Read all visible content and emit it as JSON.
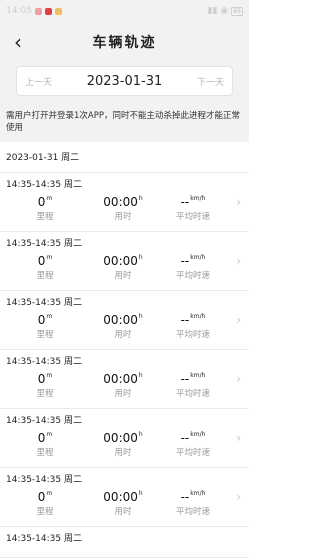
{
  "status": {
    "battery": "65"
  },
  "header": {
    "back_icon": "back-chevron",
    "title": "车辆轨迹"
  },
  "date_nav": {
    "prev": "上一天",
    "date": "2023-01-31",
    "next": "下一天"
  },
  "notice": "需用户打开并登录1次APP，同时不能主动杀掉此进程才能正常使用",
  "list_header": "2023-01-31 周二",
  "labels": {
    "distance": "里程",
    "duration": "用时",
    "avg_speed": "平均时速"
  },
  "units": {
    "distance": "m",
    "duration": "h",
    "speed": "km/h"
  },
  "records": [
    {
      "time": "14:35-14:35 周二",
      "distance": "0",
      "duration": "00:00",
      "speed": "--"
    },
    {
      "time": "14:35-14:35 周二",
      "distance": "0",
      "duration": "00:00",
      "speed": "--"
    },
    {
      "time": "14:35-14:35 周二",
      "distance": "0",
      "duration": "00:00",
      "speed": "--"
    },
    {
      "time": "14:35-14:35 周二",
      "distance": "0",
      "duration": "00:00",
      "speed": "--"
    },
    {
      "time": "14:35-14:35 周二",
      "distance": "0",
      "duration": "00:00",
      "speed": "--"
    },
    {
      "time": "14:35-14:35 周二",
      "distance": "0",
      "duration": "00:00",
      "speed": "--"
    },
    {
      "time": "14:35-14:35 周二",
      "distance": "",
      "duration": "",
      "speed": ""
    }
  ]
}
